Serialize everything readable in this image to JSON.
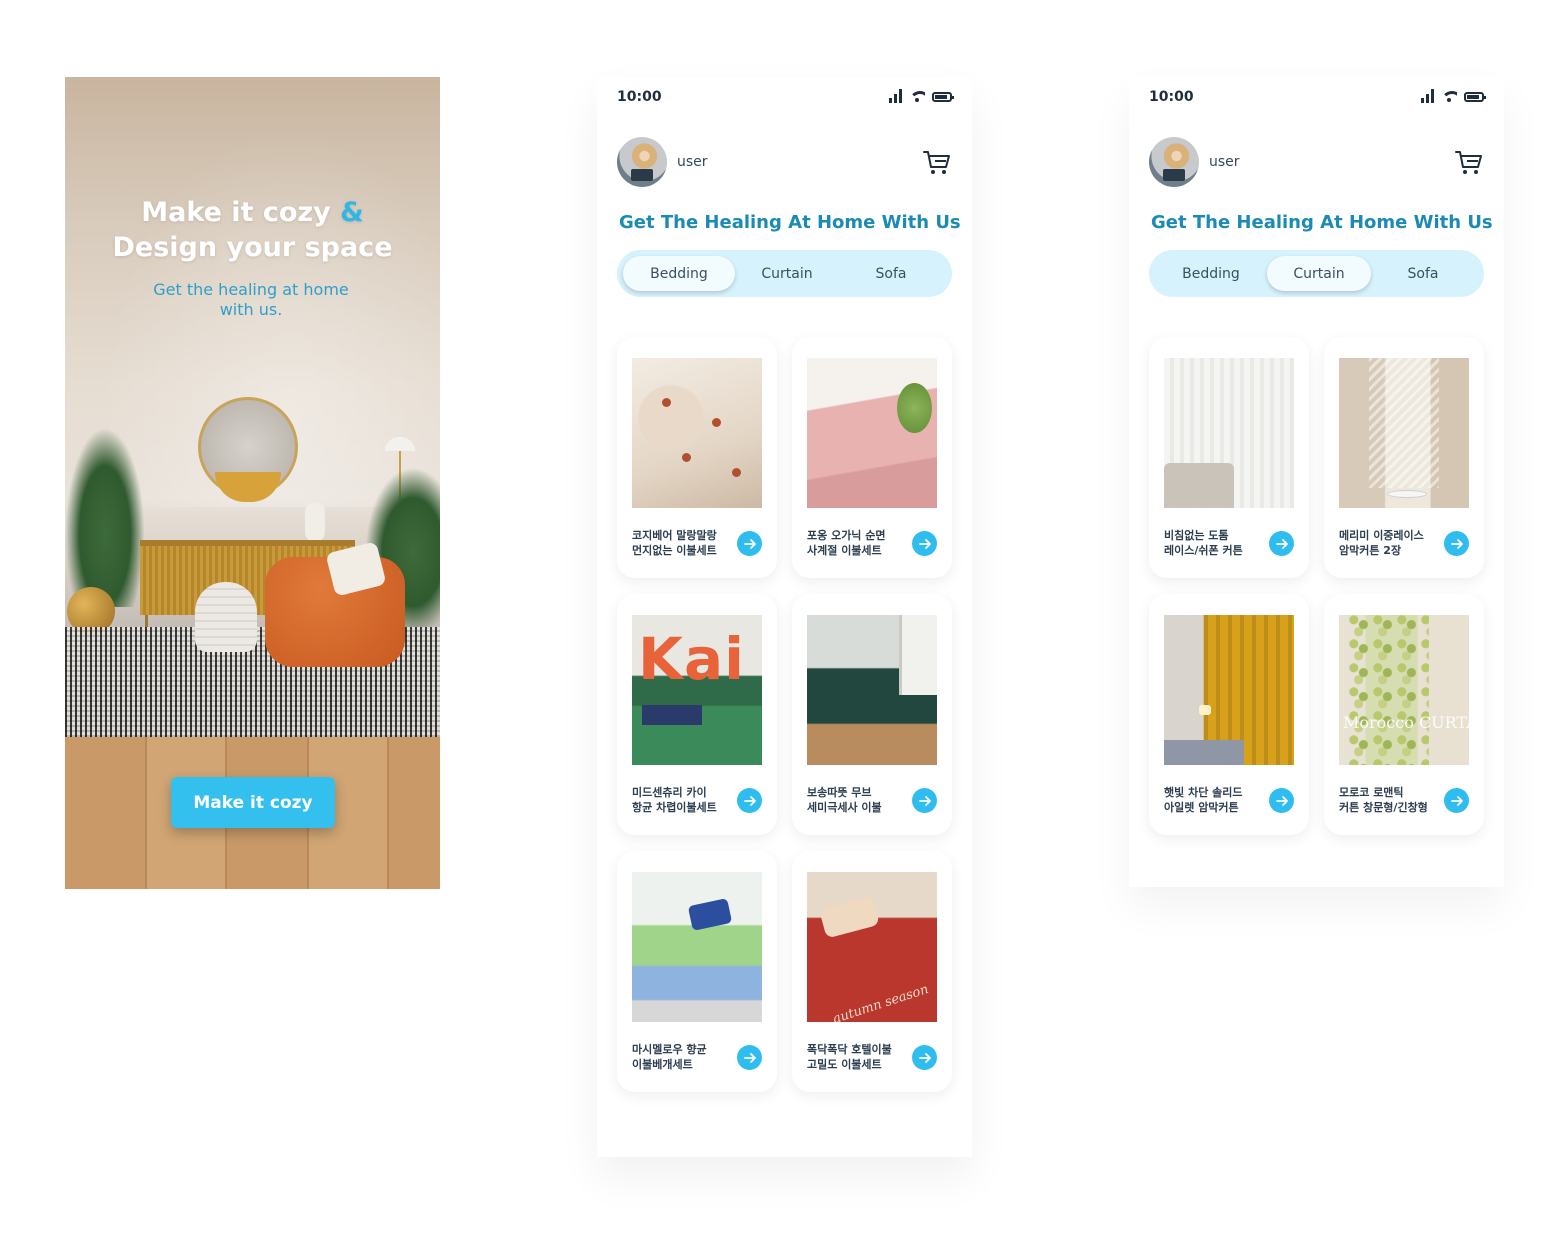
{
  "splash": {
    "title_line1": "Make it cozy",
    "title_amp": "&",
    "title_line2": "Design your space",
    "subtitle": "Get the healing at home with us.",
    "cta_label": "Make it cozy"
  },
  "status_bar": {
    "time": "10:00"
  },
  "header": {
    "username": "user"
  },
  "headline": "Get The Healing At Home With Us",
  "tabs": [
    "Bedding",
    "Curtain",
    "Sofa"
  ],
  "screens": {
    "bedding": {
      "active_tab": "Bedding",
      "products": [
        {
          "name_line1": "코지베어 말랑말랑",
          "name_line2": "먼지없는 이불세트"
        },
        {
          "name_line1": "포옹 오가닉 순면",
          "name_line2": "사계절 이불세트"
        },
        {
          "name_line1": "미드센츄리 카이",
          "name_line2": "항균 차렵이불세트",
          "image_text": "Kai"
        },
        {
          "name_line1": "보송따뜻 무브",
          "name_line2": "세미극세사 이불"
        },
        {
          "name_line1": "마시멜로우 향균",
          "name_line2": "이불베개세트"
        },
        {
          "name_line1": "폭닥폭닥 호텔이불",
          "name_line2": "고밀도 이불세트",
          "image_text": "autumn season"
        }
      ]
    },
    "curtain": {
      "active_tab": "Curtain",
      "products": [
        {
          "name_line1": "비침없는 도톰",
          "name_line2": "레이스/쉬폰 커튼"
        },
        {
          "name_line1": "메리미 이중레이스",
          "name_line2": "암막커튼 2장"
        },
        {
          "name_line1": "햇빛 차단 솔리드",
          "name_line2": "아일렛 암막커튼"
        },
        {
          "name_line1": "모로코 로맨틱",
          "name_line2": "커튼 창문형/긴창형",
          "image_text": "Morocco CURTAIN"
        }
      ]
    }
  },
  "colors": {
    "accent": "#34c0ee",
    "headline": "#1b8bb5",
    "tab_bg": "#d6f2fc",
    "arrow_button": "#2fbdf0"
  },
  "icons": [
    "cart-icon",
    "arrow-right-icon",
    "signal-icon",
    "wifi-icon",
    "battery-icon"
  ]
}
